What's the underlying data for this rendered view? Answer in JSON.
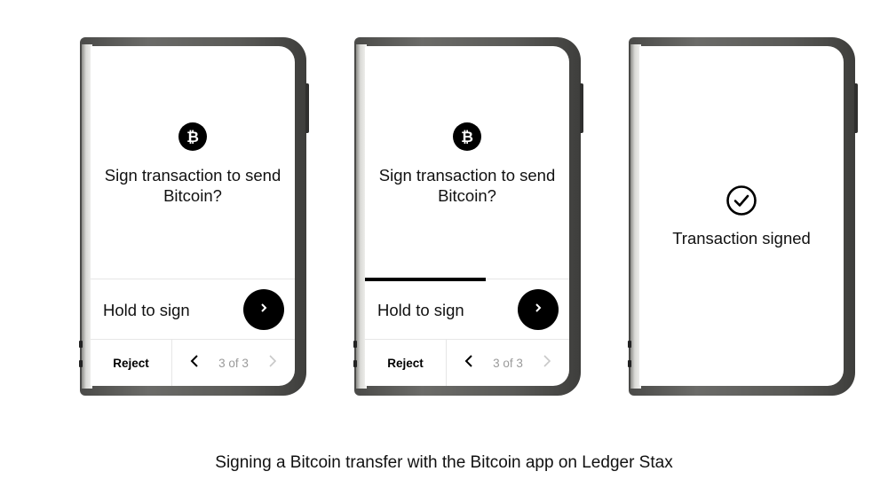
{
  "phones": [
    {
      "prompt": "Sign transaction to send Bitcoin?",
      "hold_label": "Hold to sign",
      "hold_progress": 0.0,
      "reject_label": "Reject",
      "pager": "3 of 3"
    },
    {
      "prompt": "Sign transaction to send Bitcoin?",
      "hold_label": "Hold to sign",
      "hold_progress": 0.59,
      "reject_label": "Reject",
      "pager": "3 of 3"
    },
    {
      "status": "Transaction signed"
    }
  ],
  "caption": "Signing a Bitcoin transfer with the Bitcoin app on Ledger Stax",
  "icons": {
    "coin": "bitcoin-icon",
    "next": "chevron-right-icon",
    "prev": "chevron-left-icon",
    "done": "check-circle-icon"
  },
  "colors": {
    "accent": "#000000",
    "pager_text": "#9a9a9a",
    "divider": "#e6e6e6"
  }
}
